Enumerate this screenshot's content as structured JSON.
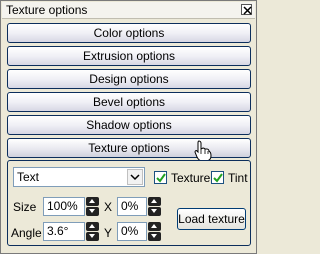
{
  "window": {
    "title": "Texture options"
  },
  "accordion": {
    "items": [
      "Color options",
      "Extrusion options",
      "Design options",
      "Bevel options",
      "Shadow options",
      "Texture options"
    ]
  },
  "texture": {
    "type_value": "Text",
    "texture_checkbox": {
      "label": "Texture",
      "checked": true
    },
    "tint_checkbox": {
      "label": "Tint",
      "checked": true
    },
    "size_label": "Size",
    "size_value": "100%",
    "x_label": "X",
    "x_value": "0%",
    "angle_label": "Angle",
    "angle_value": "3.6°",
    "y_label": "Y",
    "y_value": "0%",
    "load_button": "Load texture"
  },
  "colors": {
    "border": "#0c2e5c",
    "background": "#ece9d8",
    "check": "#21a121"
  }
}
